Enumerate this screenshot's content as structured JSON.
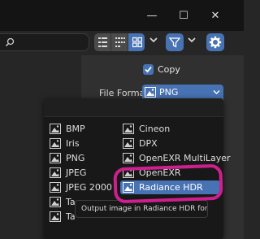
{
  "window": {
    "minimize_glyph": "—",
    "maximize_glyph": "☐",
    "close_glyph": "✕"
  },
  "toolbar": {
    "search_value": "",
    "view_buttons": [
      "vertical-list-icon",
      "horizontal-list-icon",
      "thumbnails-icon"
    ],
    "active_view": "thumbnails-icon",
    "accent_color": "#4772b3"
  },
  "settings": {
    "copy_label": "Copy",
    "copy_checked": true,
    "file_format_label": "File Format",
    "file_format_value": "PNG"
  },
  "format_menu": {
    "left_column": [
      "BMP",
      "Iris",
      "PNG",
      "JPEG",
      "JPEG 2000",
      "Ta",
      "Ta"
    ],
    "right_column": [
      "Cineon",
      "DPX",
      "OpenEXR MultiLayer",
      "OpenEXR",
      "Radiance HDR"
    ],
    "highlighted": "Radiance HDR"
  },
  "tooltip": {
    "text": "Output image in Radiance HDR format."
  },
  "annotation": {
    "color": "#cf1f8f",
    "shape": "hand-drawn rounded rectangle"
  }
}
